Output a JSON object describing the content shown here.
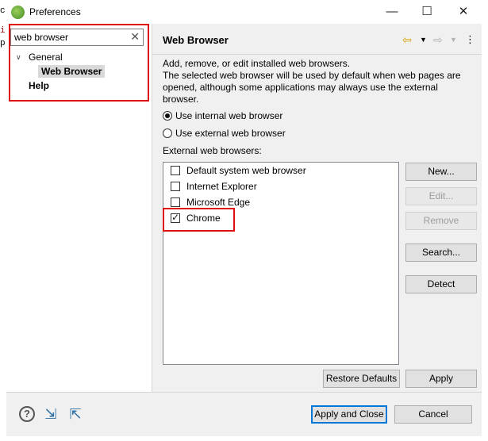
{
  "window": {
    "title": "Preferences"
  },
  "stub_left": {
    "line1": "c",
    "line2": "i",
    "line3": "p"
  },
  "sidebar": {
    "filter_value": "web browser",
    "tree": {
      "general": "General",
      "web_browser": "Web Browser",
      "help": "Help"
    }
  },
  "page": {
    "title": "Web Browser",
    "description": "Add, remove, or edit installed web browsers.\nThe selected web browser will be used by default when web pages are opened, although some applications may always use the external browser.",
    "radio_internal": "Use internal web browser",
    "radio_external": "Use external web browser",
    "list_label": "External web browsers:",
    "browsers": [
      {
        "label": "Default system web browser",
        "checked": false
      },
      {
        "label": "Internet Explorer",
        "checked": false
      },
      {
        "label": "Microsoft Edge",
        "checked": false
      },
      {
        "label": "Chrome",
        "checked": true
      }
    ],
    "buttons": {
      "new": "New...",
      "edit": "Edit...",
      "remove": "Remove",
      "search": "Search...",
      "detect": "Detect"
    },
    "restore_defaults": "Restore Defaults",
    "apply": "Apply"
  },
  "footer": {
    "apply_close": "Apply and Close",
    "cancel": "Cancel"
  },
  "icons": {
    "help": "help-icon",
    "import": "import-icon",
    "export": "export-icon"
  },
  "colors": {
    "highlight": "#e01010",
    "accent": "#0078d7"
  }
}
